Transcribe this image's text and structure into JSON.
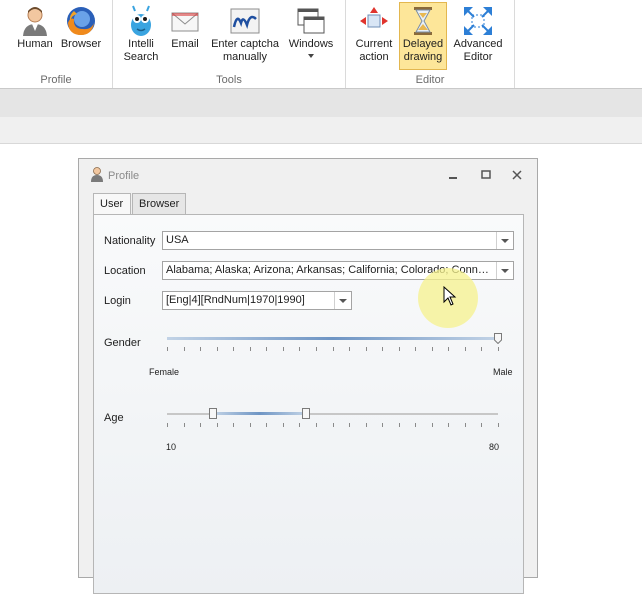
{
  "ribbon": {
    "groups": [
      {
        "label": "Profile",
        "buttons": [
          {
            "label": "Human",
            "icon": "human-icon"
          },
          {
            "label": "Browser",
            "icon": "firefox-icon"
          }
        ]
      },
      {
        "label": "Tools",
        "buttons": [
          {
            "label": "Intelli\nSearch",
            "icon": "intelli-search-icon"
          },
          {
            "label": "Email",
            "icon": "email-icon"
          },
          {
            "label": "Enter captcha\nmanually",
            "icon": "captcha-icon"
          },
          {
            "label": "Windows",
            "icon": "windows-icon"
          }
        ]
      },
      {
        "label": "Editor",
        "buttons": [
          {
            "label": "Current\naction",
            "icon": "current-action-icon"
          },
          {
            "label": "Delayed\ndrawing",
            "icon": "hourglass-icon",
            "active": true
          },
          {
            "label": "Advanced\nEditor",
            "icon": "expand-arrows-icon"
          }
        ]
      }
    ]
  },
  "window": {
    "title": "Profile",
    "tabs": [
      {
        "label": "User",
        "selected": true
      },
      {
        "label": "Browser",
        "selected": false
      }
    ],
    "fields": {
      "nationality": {
        "label": "Nationality",
        "value": "USA"
      },
      "location": {
        "label": "Location",
        "value": "Alabama; Alaska; Arizona; Arkansas; California; Colorado; Connecticut"
      },
      "login": {
        "label": "Login",
        "value": "[Eng|4][RndNum|1970|1990]"
      },
      "gender": {
        "label": "Gender",
        "min_label": "Female",
        "max_label": "Male",
        "value": 1.0
      },
      "age": {
        "label": "Age",
        "min_label": "10",
        "max_label": "80",
        "range": [
          0.14,
          0.42
        ]
      }
    }
  },
  "colors": {
    "accent": "#fde699",
    "accent_border": "#e3b74f",
    "slider_fill": "#6e95c4"
  }
}
